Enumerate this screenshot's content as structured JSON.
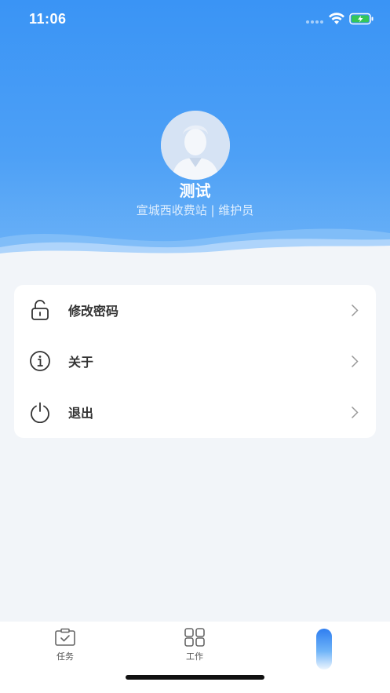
{
  "status_bar": {
    "time": "11:06"
  },
  "profile": {
    "name": "测试",
    "role": "宣城西收费站 | 维护员"
  },
  "menu": [
    {
      "label": "修改密码",
      "icon": "unlock-icon"
    },
    {
      "label": "关于",
      "icon": "info-icon"
    },
    {
      "label": "退出",
      "icon": "power-icon"
    }
  ],
  "tabs": [
    {
      "label": "任务",
      "icon": "task-clipboard-icon"
    },
    {
      "label": "工作",
      "icon": "grid-apps-icon"
    }
  ],
  "colors": {
    "primary": "#3a94f5",
    "background": "#f2f5f9"
  }
}
